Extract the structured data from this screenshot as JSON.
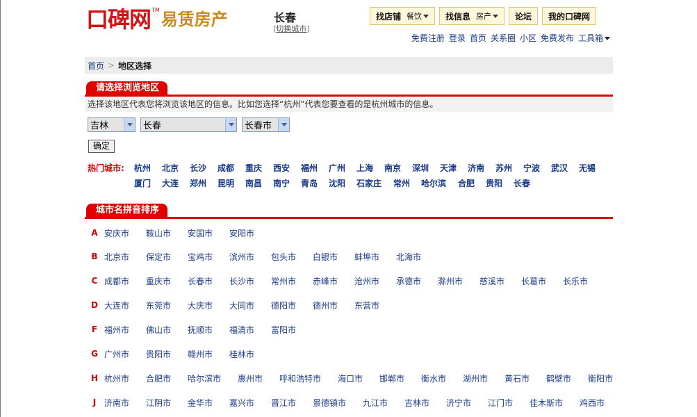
{
  "header": {
    "logo_main": "口碑网",
    "logo_tm": "TM",
    "logo_sub": "易赁房产",
    "city": "长春",
    "switch_city": "切换城市"
  },
  "top_buttons": [
    {
      "label": "找店铺",
      "select": "餐饮"
    },
    {
      "label": "找信息",
      "select": "房产"
    },
    {
      "label": "论坛"
    },
    {
      "label": "我的口碑网"
    }
  ],
  "top_links": [
    "免费注册",
    "登录",
    "首页",
    "关系圈",
    "小区",
    "免费发布",
    "工具箱"
  ],
  "breadcrumb": {
    "home": "首页",
    "current": "地区选择"
  },
  "browse_section": {
    "title": "请选择浏览地区",
    "description": "选择该地区代表您将浏览该地区的信息。比如您选择“杭州”代表您要查看的是杭州城市的信息。",
    "province": "吉林",
    "city": "长春",
    "district": "长春市",
    "confirm": "确定"
  },
  "hot_cities": {
    "label": "热门城市:",
    "row1": [
      "杭州",
      "北京",
      "长沙",
      "成都",
      "重庆",
      "西安",
      "福州",
      "广州",
      "上海",
      "南京",
      "深圳",
      "天津",
      "济南",
      "苏州",
      "宁波",
      "武汉",
      "无锡"
    ],
    "row2": [
      "厦门",
      "大连",
      "郑州",
      "昆明",
      "南昌",
      "南宁",
      "青岛",
      "沈阳",
      "石家庄",
      "常州",
      "哈尔滨",
      "合肥",
      "贵阳",
      "长春"
    ]
  },
  "pinyin_section": {
    "title": "城市名拼音排序",
    "groups": [
      {
        "letter": "A",
        "cities": [
          "安庆市",
          "鞍山市",
          "安国市",
          "安阳市"
        ]
      },
      {
        "letter": "B",
        "cities": [
          "北京市",
          "保定市",
          "宝鸡市",
          "滨州市",
          "包头市",
          "白银市",
          "蚌埠市",
          "北海市"
        ]
      },
      {
        "letter": "C",
        "cities": [
          "成都市",
          "重庆市",
          "长春市",
          "长沙市",
          "常州市",
          "赤峰市",
          "沧州市",
          "承德市",
          "滁州市",
          "慈溪市",
          "长葛市",
          "长乐市"
        ]
      },
      {
        "letter": "D",
        "cities": [
          "大连市",
          "东莞市",
          "大庆市",
          "大同市",
          "德阳市",
          "德州市",
          "东营市"
        ]
      },
      {
        "letter": "F",
        "cities": [
          "福州市",
          "佛山市",
          "抚顺市",
          "福清市",
          "富阳市"
        ]
      },
      {
        "letter": "G",
        "cities": [
          "广州市",
          "贵阳市",
          "赣州市",
          "桂林市"
        ]
      },
      {
        "letter": "H",
        "cities": [
          "杭州市",
          "合肥市",
          "哈尔滨市",
          "惠州市",
          "呼和浩特市",
          "海口市",
          "邯郸市",
          "衡水市",
          "湖州市",
          "黄石市",
          "鹤壁市",
          "衡阳市"
        ]
      },
      {
        "letter": "J",
        "cities": [
          "济南市",
          "江阴市",
          "金华市",
          "嘉兴市",
          "晋江市",
          "景德镇市",
          "九江市",
          "吉林市",
          "济宁市",
          "江门市",
          "佳木斯市",
          "鸡西市"
        ]
      }
    ]
  }
}
